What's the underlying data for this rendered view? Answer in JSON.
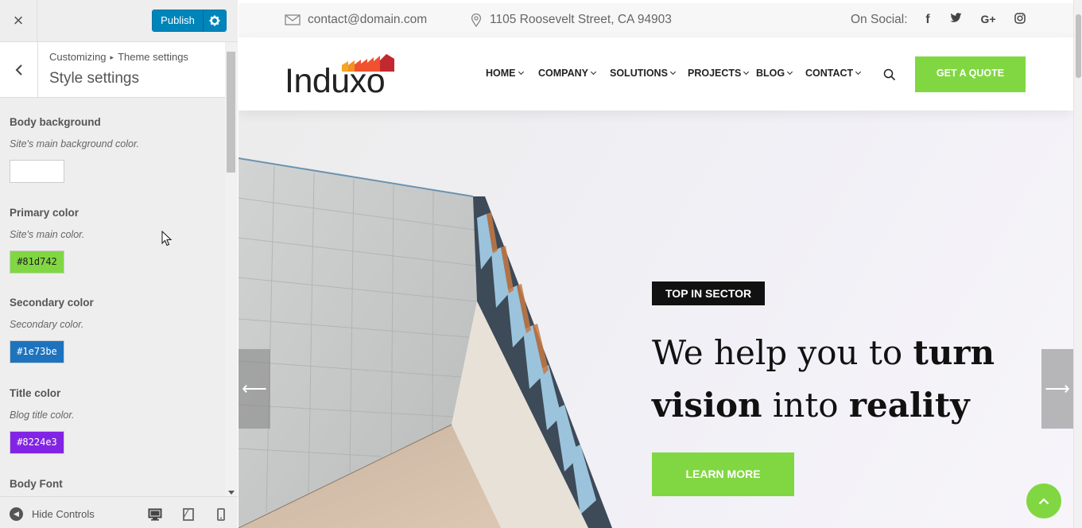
{
  "customizer": {
    "close_label": "×",
    "publish_label": "Publish",
    "breadcrumb_root": "Customizing",
    "breadcrumb_sep": "▸",
    "breadcrumb_parent": "Theme settings",
    "section_title": "Style settings",
    "controls": [
      {
        "label": "Body background",
        "desc": "Site's main background color.",
        "value": "",
        "color": "#ffffff"
      },
      {
        "label": "Primary color",
        "desc": "Site's main color.",
        "value": "#81d742",
        "color": "#81d742"
      },
      {
        "label": "Secondary color",
        "desc": "Secondary color.",
        "value": "#1e73be",
        "color": "#1e73be"
      },
      {
        "label": "Title color",
        "desc": "Blog title color.",
        "value": "#8224e3",
        "color": "#8224e3"
      },
      {
        "label": "Body Font"
      }
    ],
    "hide_controls_label": "Hide Controls"
  },
  "site": {
    "topbar": {
      "email": "contact@domain.com",
      "address": "1105 Roosevelt Street, CA 94903",
      "social_label": "On Social:",
      "social": [
        "facebook-icon",
        "twitter-icon",
        "google-plus-icon",
        "instagram-icon"
      ]
    },
    "logo": "Induxo",
    "nav": [
      "HOME",
      "COMPANY",
      "SOLUTIONS",
      "PROJECTS",
      "BLOG",
      "CONTACT"
    ],
    "quote_label": "GET A QUOTE",
    "hero": {
      "badge": "TOP IN SECTOR",
      "headline_1": "We help you to ",
      "headline_2": "turn",
      "headline_3": "vision",
      "headline_4": " into ",
      "headline_5": "reality",
      "cta": "LEARN MORE",
      "prev": "⟵",
      "next": "⟶"
    }
  },
  "colors": {
    "primary": "#81d742",
    "publish": "#0085ba"
  }
}
